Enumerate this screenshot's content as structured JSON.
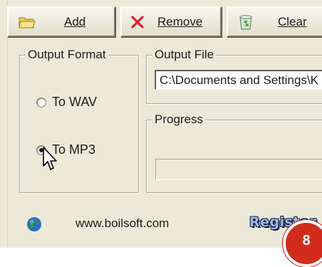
{
  "toolbar": {
    "add_label": "Add",
    "remove_label": "Remove",
    "clear_label": "Clear"
  },
  "output_format": {
    "legend": "Output Format",
    "options": [
      {
        "label": "To WAV",
        "selected": false
      },
      {
        "label": "To MP3",
        "selected": true
      }
    ]
  },
  "output_file": {
    "legend": "Output File",
    "value": "C:\\Documents and Settings\\K"
  },
  "progress": {
    "legend": "Progress"
  },
  "footer": {
    "website": "www.boilsoft.com",
    "register_label": "Register"
  },
  "badge": {
    "number": "8"
  },
  "colors": {
    "window_bg": "#ece9d8",
    "remove_x": "#d8232a",
    "register_text": "#a2b6de",
    "badge_red": "#d22d1c"
  },
  "icons": [
    "folder-icon",
    "remove-x-icon",
    "recycle-bin-icon",
    "globe-icon",
    "mouse-cursor-icon"
  ]
}
